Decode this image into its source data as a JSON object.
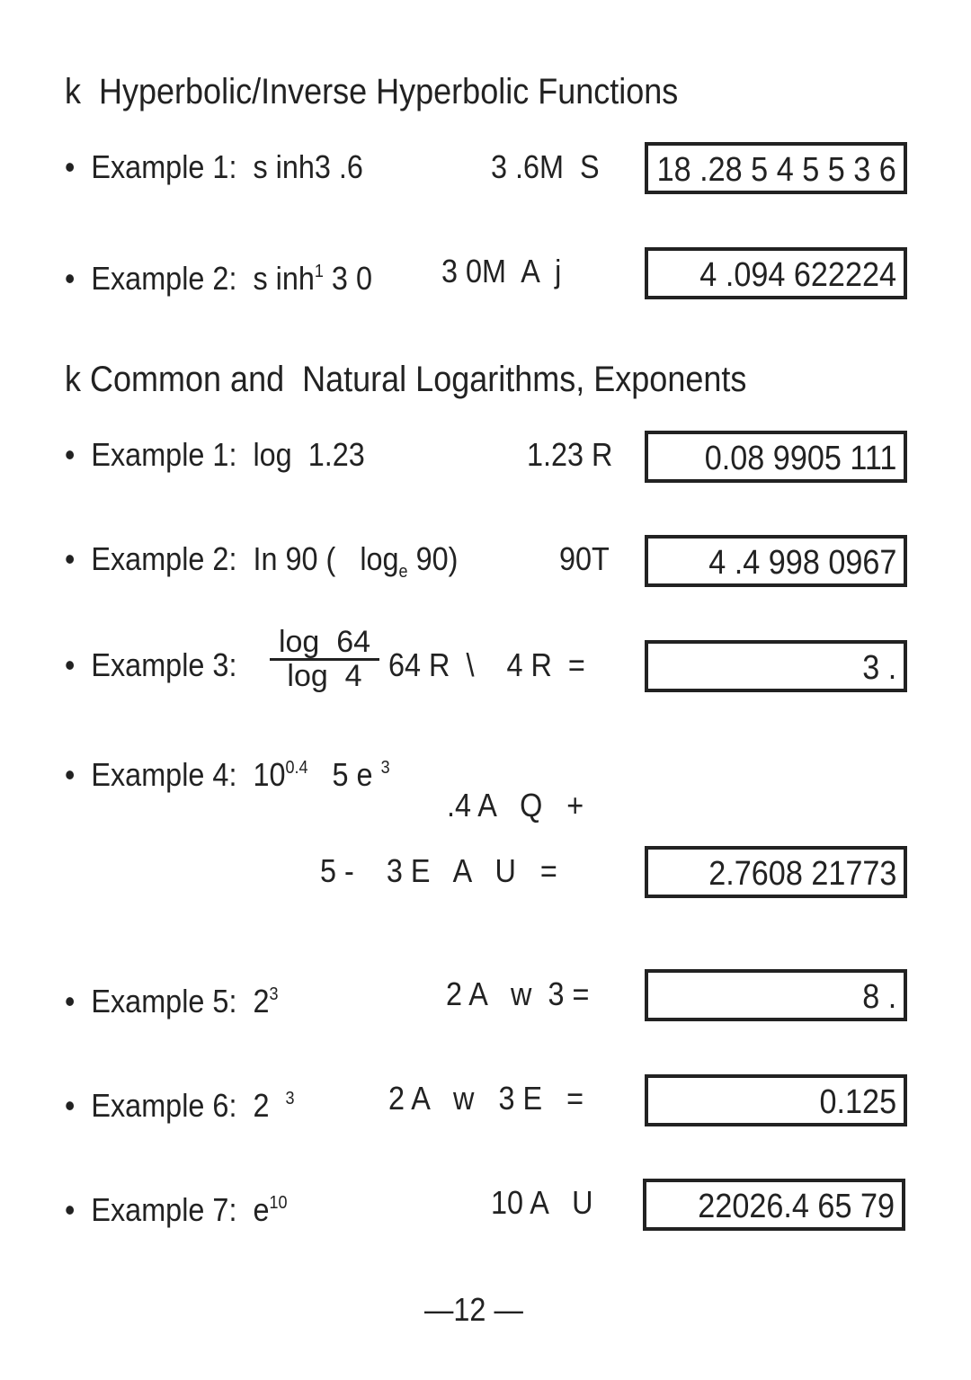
{
  "sections": [
    {
      "bullet": "k",
      "title": "Hyperbolic/Inverse Hyperbolic Functions",
      "examples": [
        {
          "label": "Example 1:",
          "expr": "s inh3 .6",
          "keys": "3 .6M  S",
          "display": "18 .28 5 4 5 5 3 6"
        },
        {
          "label": "Example 2:",
          "expr_a": "s inh",
          "expr_sup": "1",
          "expr_b": " 3 0",
          "keys": "3 0M  A  j",
          "display": "4 .094 622224"
        }
      ]
    },
    {
      "bullet": "k",
      "title": "Common and  Natural Logarithms, Exponents",
      "examples": [
        {
          "label": "Example 1:",
          "expr": "log  1.23",
          "keys": "1.23 R",
          "display": "0.08 9905 111"
        },
        {
          "label": "Example 2:",
          "expr_a": "In 90 (   log",
          "expr_sub": "e",
          "expr_b": " 90)",
          "keys": "90T",
          "display": "4 .4 998 0967"
        },
        {
          "label": "Example 3:",
          "numerator": "log  64",
          "denominator": "log  4",
          "keys": "64 R  \\    4 R  =",
          "display": "3 ."
        },
        {
          "label": "Example 4:",
          "expr_a": "10",
          "expr_sup": "0.4",
          "expr_b": "   5 e ",
          "expr_sup2": "3",
          "keys_line1": ".4 A   Q   +",
          "keys_line2": "5 -    3 E   A   U   =",
          "display": "2.7608 21773"
        },
        {
          "label": "Example 5:",
          "expr_a": "2",
          "expr_sup": "3",
          "keys": "2 A   w  3 =",
          "display": "8 ."
        },
        {
          "label": "Example 6:",
          "expr_a": "2 ",
          "expr_sup": "3",
          "keys": "2 A   w   3 E   =",
          "display": "0.125"
        },
        {
          "label": "Example 7:",
          "expr_a": "e",
          "expr_sup": "10",
          "keys": "10 A   U",
          "display": "22026.4 65 79"
        }
      ]
    }
  ],
  "bullet_dot": "•",
  "page_number": "—12 —"
}
